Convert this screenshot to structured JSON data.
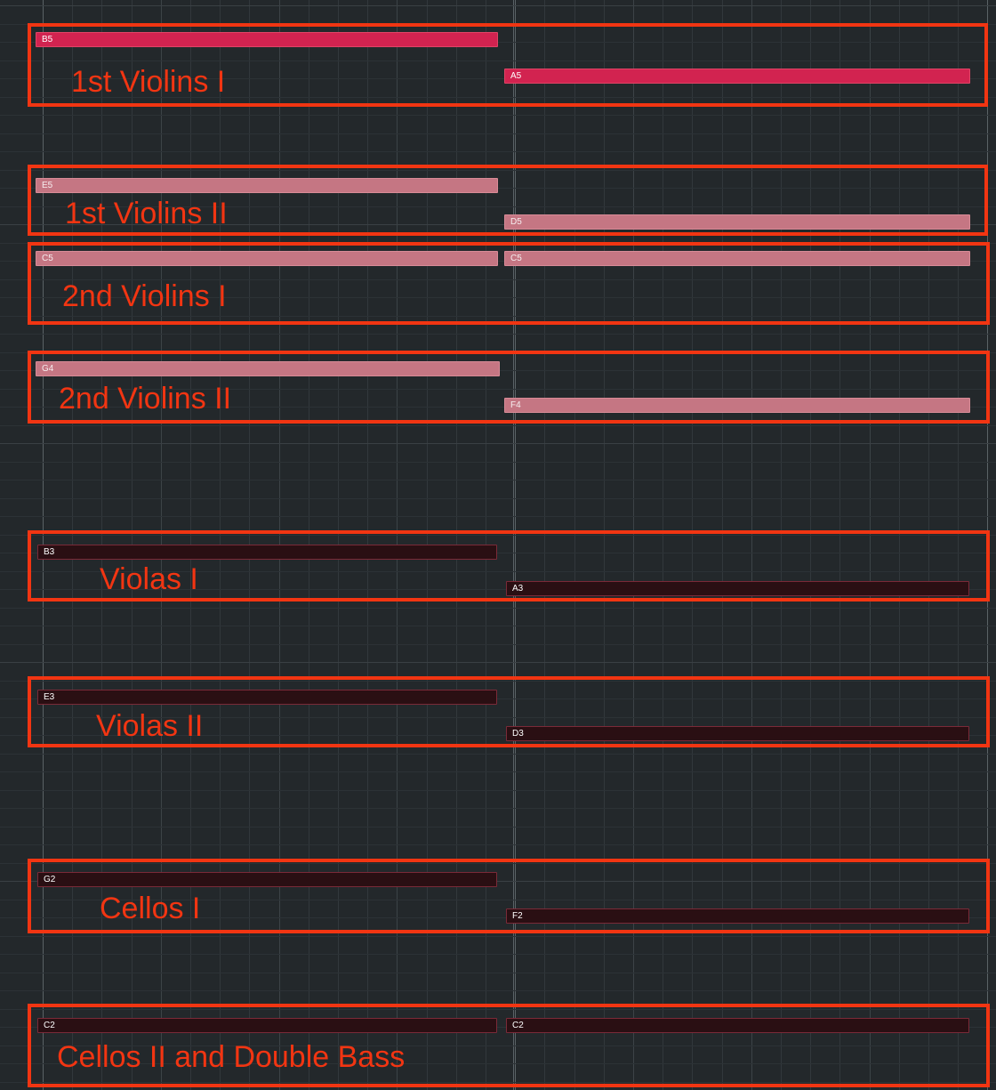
{
  "groups": [
    {
      "label": "1st Violins I",
      "notes": [
        "B5",
        "A5"
      ],
      "style": "hot"
    },
    {
      "label": "1st Violins II",
      "notes": [
        "E5",
        "D5"
      ],
      "style": "pink"
    },
    {
      "label": "2nd Violins I",
      "notes": [
        "C5",
        "C5"
      ],
      "style": "pink"
    },
    {
      "label": "2nd Violins II",
      "notes": [
        "G4",
        "F4"
      ],
      "style": "pink"
    },
    {
      "label": "Violas I",
      "notes": [
        "B3",
        "A3"
      ],
      "style": "dark"
    },
    {
      "label": "Violas II",
      "notes": [
        "E3",
        "D3"
      ],
      "style": "dark"
    },
    {
      "label": "Cellos I",
      "notes": [
        "G2",
        "F2"
      ],
      "style": "dark"
    },
    {
      "label": "Cellos II and Double Bass",
      "notes": [
        "C2",
        "C2"
      ],
      "style": "dark"
    }
  ],
  "colors": {
    "annotation": "#f23512",
    "note_hot": "#d22350",
    "note_pink": "#c57683",
    "note_dark": "#2a0f13",
    "background": "#23282b"
  }
}
